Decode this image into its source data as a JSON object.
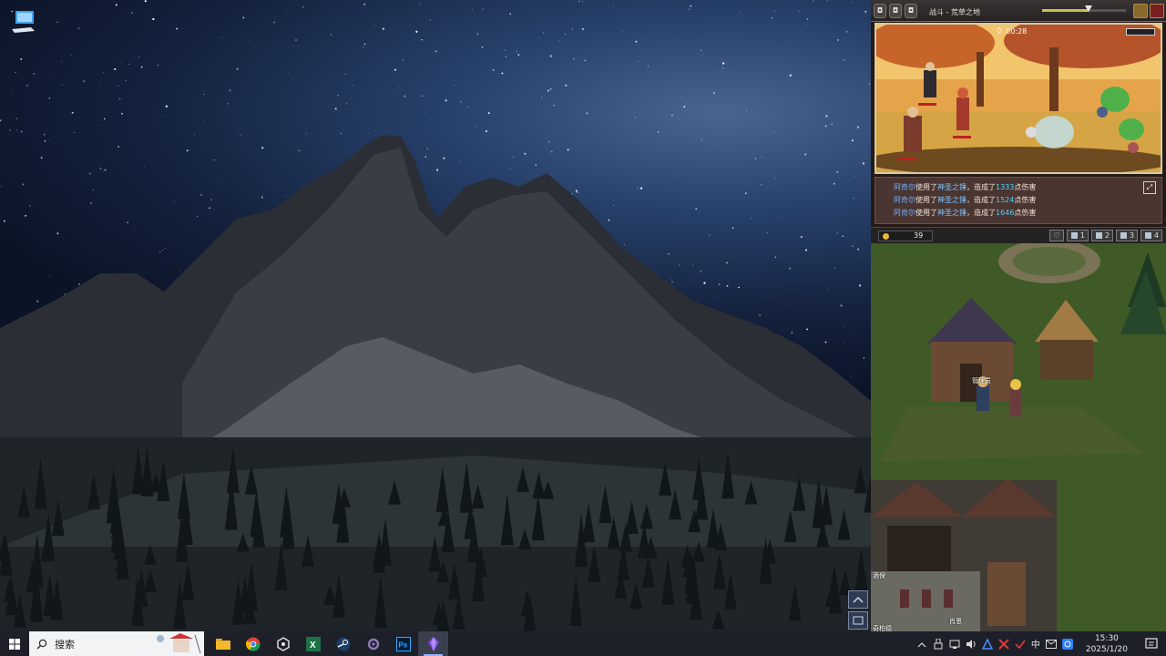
{
  "desktop": {
    "icons": [
      {
        "icon": "this-pc-icon"
      }
    ],
    "scroll_buttons": [
      {
        "icon": "chevron-up-icon"
      },
      {
        "icon": "chevron-down-icon"
      }
    ]
  },
  "taskbar": {
    "search_placeholder": "搜索",
    "apps": [
      {
        "name": "file-explorer",
        "icon": "folder-icon"
      },
      {
        "name": "chrome",
        "icon": "chrome-icon"
      },
      {
        "name": "app-hex",
        "icon": "hexagon-app-icon"
      },
      {
        "name": "excel",
        "icon": "excel-icon"
      },
      {
        "name": "steam",
        "icon": "steam-icon"
      },
      {
        "name": "app-gear",
        "icon": "gear-app-icon"
      },
      {
        "name": "photoshop",
        "icon": "photoshop-icon",
        "label": "Ps"
      },
      {
        "name": "game",
        "icon": "game-crystal-icon",
        "active": true
      }
    ],
    "tray": {
      "ime": "中",
      "time": "15:30",
      "date": "2025/1/20"
    }
  },
  "game": {
    "title": "战斗 - 荒草之地",
    "volume": 0.55,
    "battle": {
      "timer": "00:28"
    },
    "log": [
      {
        "actor": "阿奇尔",
        "verb": "使用了",
        "skill": "神圣之锤",
        "mid": "，造成了",
        "damage": "1333",
        "suffix": "点伤害"
      },
      {
        "actor": "阿奇尔",
        "verb": "使用了",
        "skill": "神圣之锤",
        "mid": "，造成了",
        "damage": "1524",
        "suffix": "点伤害"
      },
      {
        "actor": "阿奇尔",
        "verb": "使用了",
        "skill": "神圣之锤",
        "mid": "，造成了",
        "damage": "1646",
        "suffix": "点伤害"
      }
    ],
    "gold": "39",
    "slots": [
      "1",
      "2",
      "3",
      "4"
    ],
    "map_labels": {
      "manager": "管理员",
      "left_npc": "酒保",
      "left_npc2": "奇柏德",
      "bottom": "肖恩"
    }
  },
  "colors": {
    "accent": "#8fb4ff",
    "damage": "#4ad2ff",
    "name": "#6fb0ff"
  }
}
